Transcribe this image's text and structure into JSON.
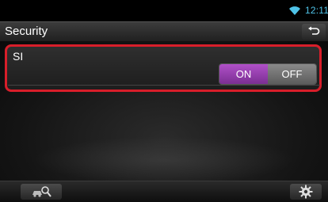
{
  "status": {
    "time": "12:11",
    "signal_icon": "wifi-icon"
  },
  "header": {
    "title": "Security",
    "back_icon": "back-arrow-icon"
  },
  "setting": {
    "label": "SI",
    "options": [
      "ON",
      "OFF"
    ],
    "selected": "ON"
  },
  "footer": {
    "left_icon": "search-vehicle-icon",
    "right_icon": "gear-icon"
  },
  "colors": {
    "accent": "#4fc3e8",
    "on": "#9a40b4",
    "highlight": "#d81e2a"
  }
}
